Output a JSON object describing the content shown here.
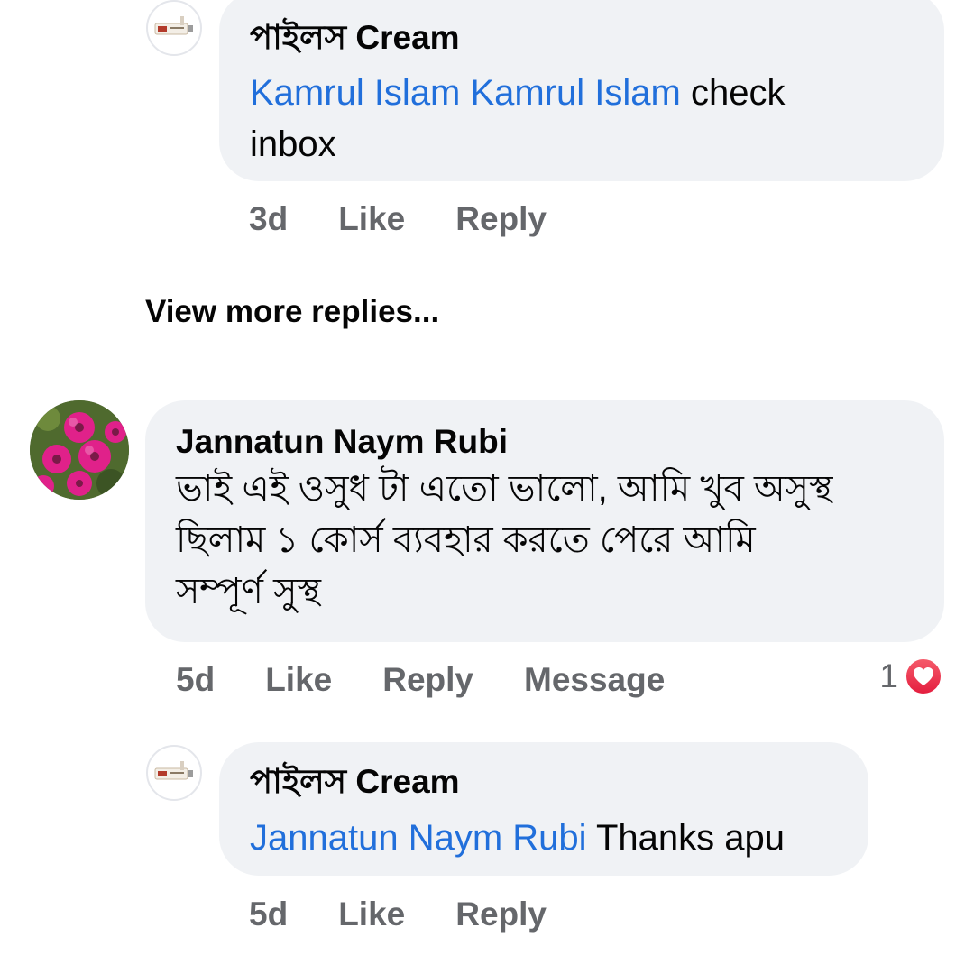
{
  "view_more": "View more replies...",
  "comments": [
    {
      "author": "পাইলস Cream",
      "mention": "Kamrul Islam Kamrul Islam",
      "text_line1": " check",
      "text_line2": "inbox",
      "time": "3d",
      "like": "Like",
      "reply": "Reply"
    },
    {
      "author": "Jannatun Naym Rubi",
      "lines": [
        "ভাই এই ওসুধ টা এতো ভালো, আমি খুব অসুস্থ",
        "ছিলাম  ১ কোর্স ব্যবহার করতে পেরে আমি",
        "সম্পূর্ণ সুস্থ"
      ],
      "time": "5d",
      "like": "Like",
      "reply": "Reply",
      "message": "Message",
      "reaction_count": "1",
      "reaction_icon": "heart-icon"
    },
    {
      "author": "পাইলস Cream",
      "mention": "Jannatun Naym Rubi",
      "text": " Thanks apu",
      "time": "5d",
      "like": "Like",
      "reply": "Reply"
    }
  ],
  "colors": {
    "mention": "#216fdb",
    "bubble": "#f0f2f5",
    "meta": "#65676b",
    "heart": "#e41e3f"
  }
}
